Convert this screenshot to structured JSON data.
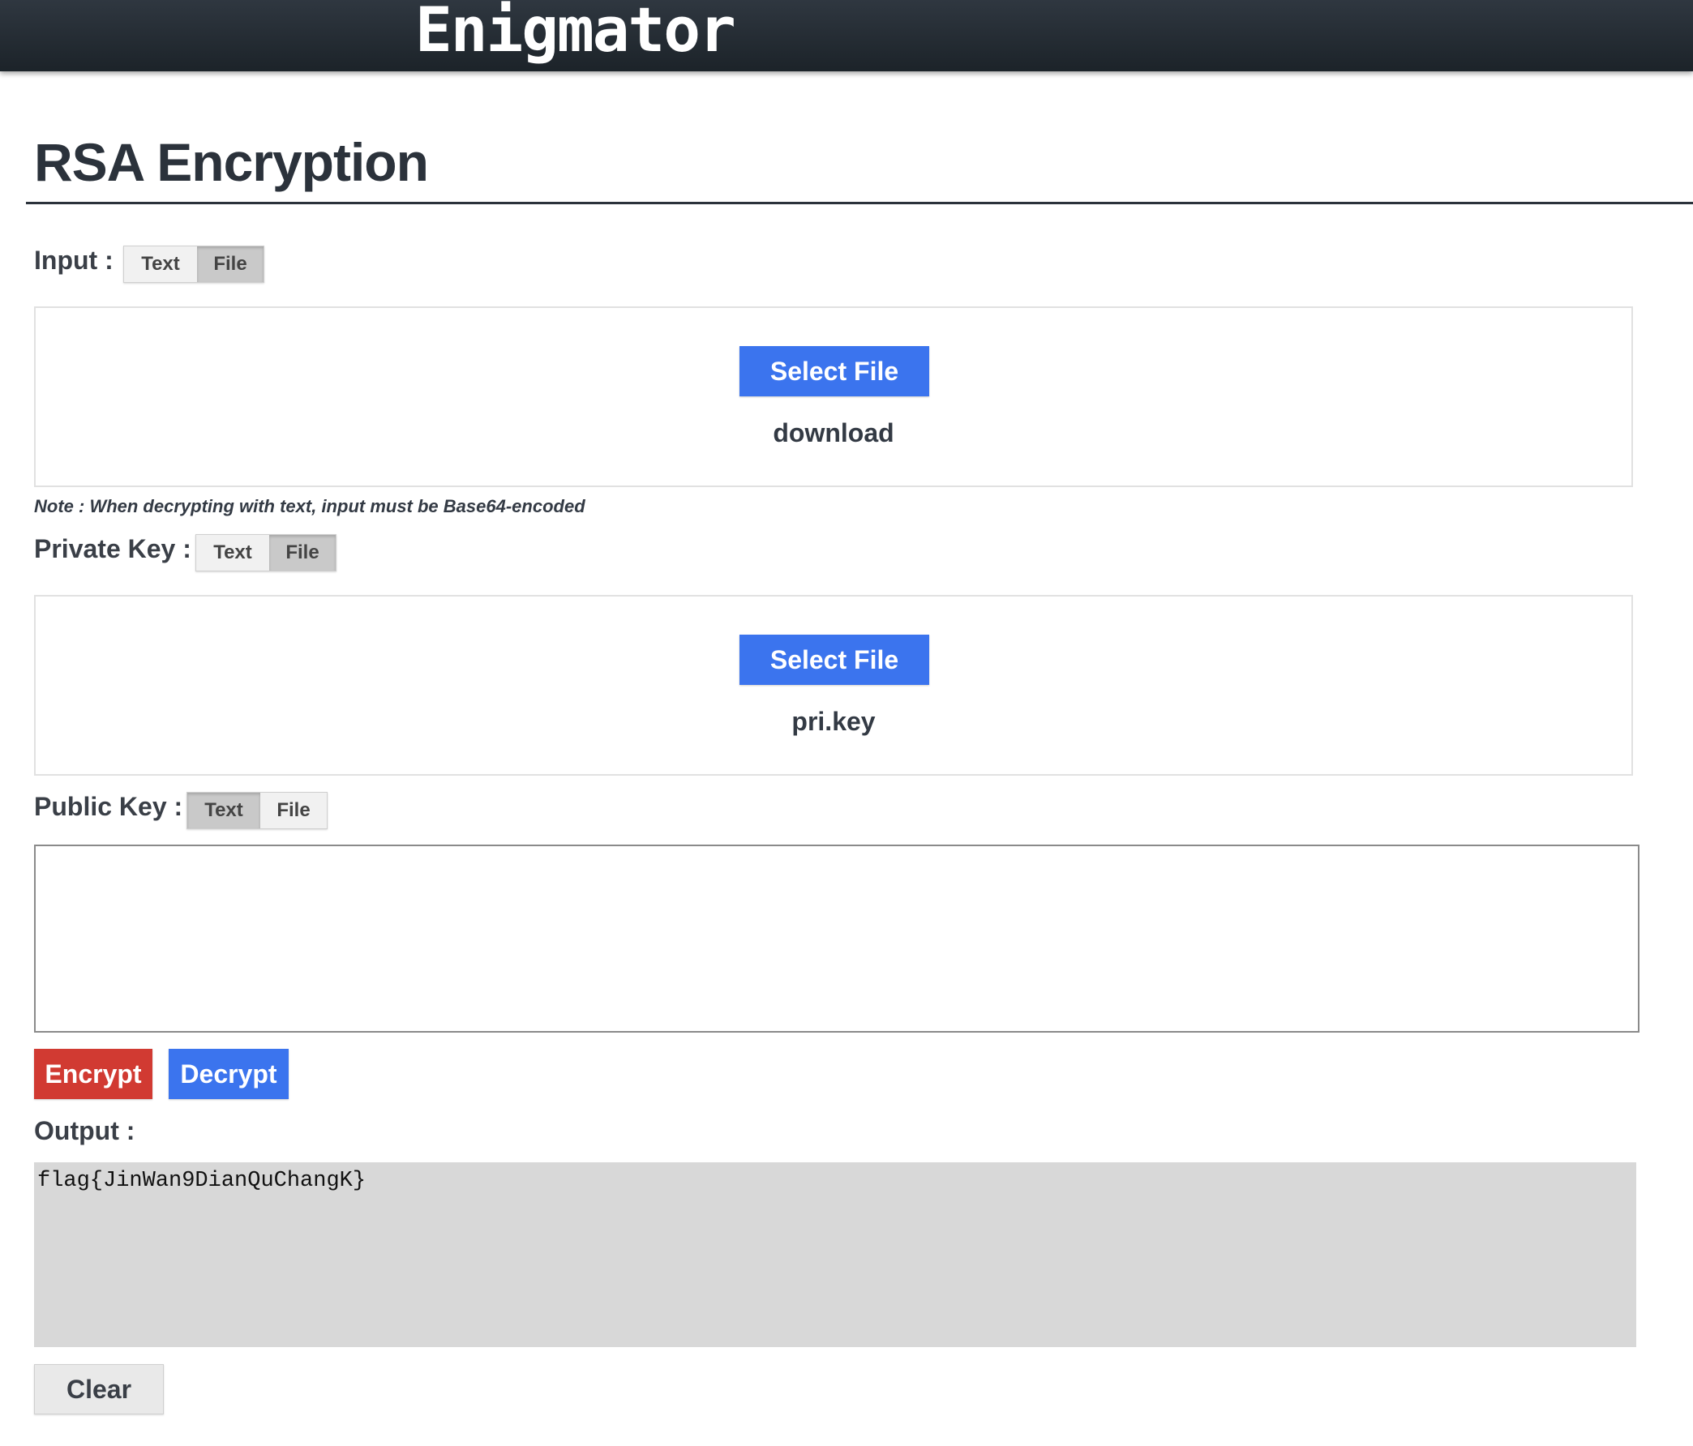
{
  "header": {
    "brand": "Enigmator"
  },
  "page": {
    "title": "RSA Encryption"
  },
  "input": {
    "label": "Input :",
    "toggle": {
      "text_label": "Text",
      "file_label": "File",
      "selected": "File"
    },
    "select_file_label": "Select File",
    "file_name": "download"
  },
  "note": "Note : When decrypting with text, input must be Base64-encoded",
  "private_key": {
    "label": "Private Key :",
    "toggle": {
      "text_label": "Text",
      "file_label": "File",
      "selected": "File"
    },
    "select_file_label": "Select File",
    "file_name": "pri.key"
  },
  "public_key": {
    "label": "Public Key :",
    "toggle": {
      "text_label": "Text",
      "file_label": "File",
      "selected": "Text"
    },
    "value": ""
  },
  "actions": {
    "encrypt_label": "Encrypt",
    "decrypt_label": "Decrypt"
  },
  "output": {
    "label": "Output :",
    "value": "flag{JinWan9DianQuChangK}"
  },
  "clear_label": "Clear",
  "colors": {
    "topbar": "#1c2329",
    "primary_blue": "#3b74ee",
    "danger_red": "#d13a32",
    "output_bg": "#d8d8d8"
  }
}
